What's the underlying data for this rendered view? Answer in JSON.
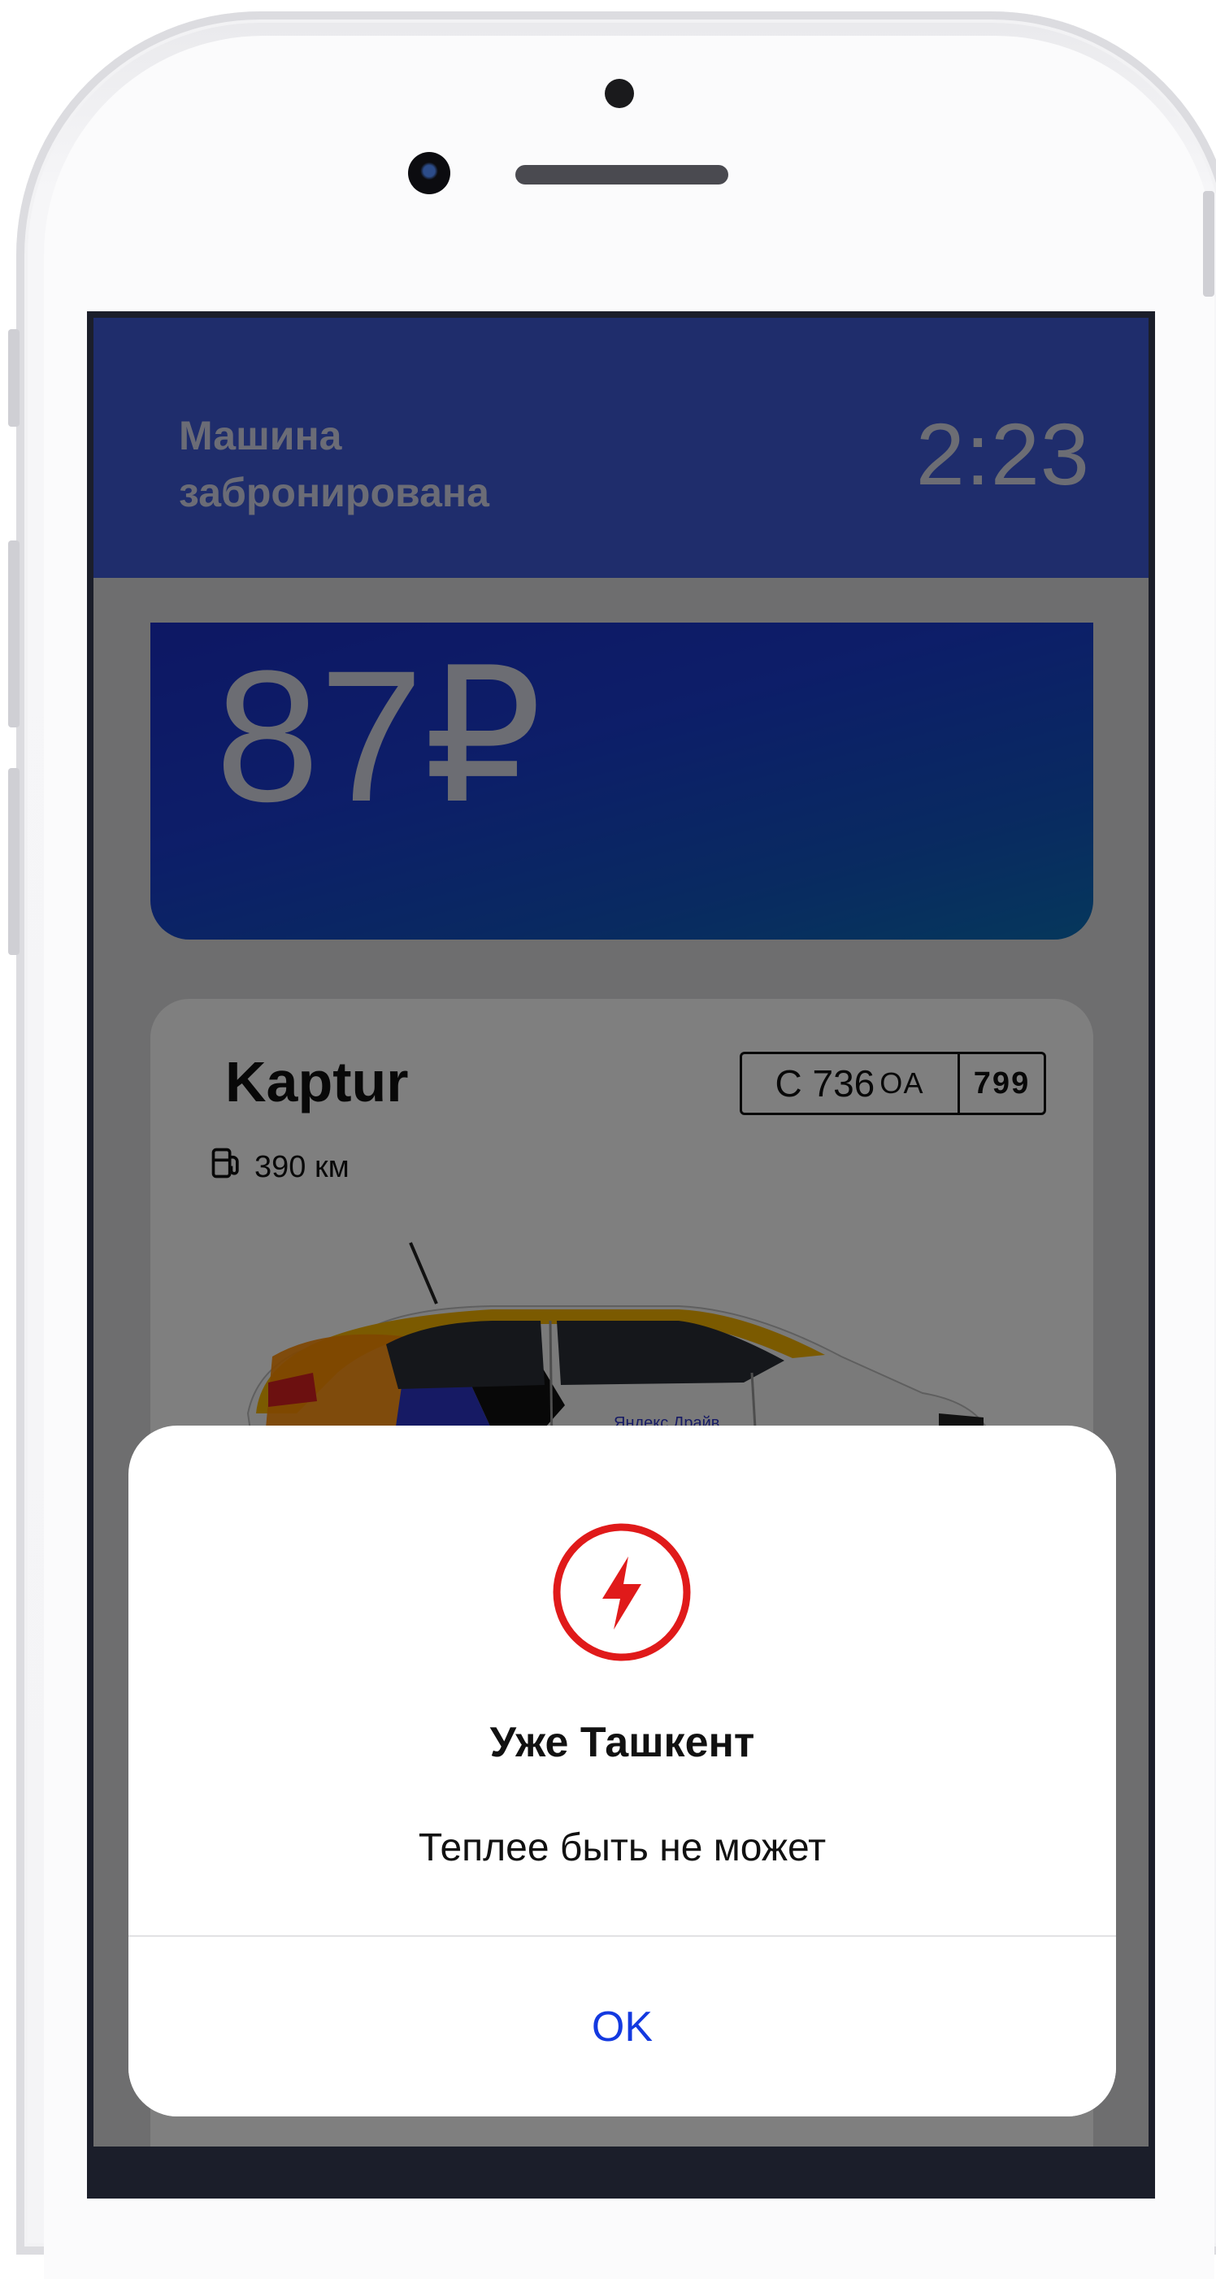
{
  "header": {
    "status_line1": "Машина",
    "status_line2": "забронирована",
    "timer": "2:23"
  },
  "price": {
    "amount": "87₽"
  },
  "car": {
    "model": "Kaptur",
    "plate_number": "С 736",
    "plate_letters": "ОА",
    "plate_region": "799",
    "fuel_range": "390 км",
    "livery_text": "Яндекс.Драйв"
  },
  "dialog": {
    "icon": "lightning-icon",
    "title": "Уже Ташкент",
    "message": "Теплее быть не может",
    "ok_label": "OK"
  },
  "colors": {
    "header_bg": "#3e5bd8",
    "price_card": "#1a3cd2",
    "alert_red": "#e01a1a",
    "ok_blue": "#1339e0",
    "livery_yellow": "#f7b500"
  }
}
